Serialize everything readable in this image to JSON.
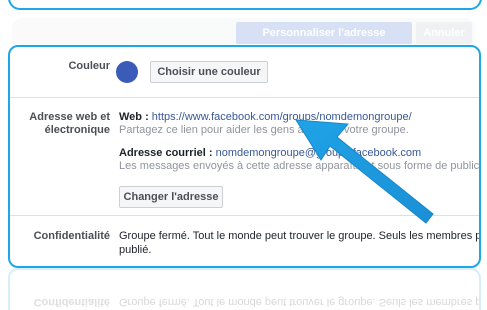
{
  "header": {
    "primary_button": "Personnaliser l'adresse",
    "secondary_button": "Annuler"
  },
  "color_row": {
    "label": "Couleur",
    "swatch_color": "#3b5bb8",
    "button": "Choisir une couleur"
  },
  "address_row": {
    "label_line1": "Adresse web et",
    "label_line2": "électronique",
    "web_prefix": "Web : ",
    "web_url": "https://www.facebook.com/groups/nomdemongroupe/",
    "web_hint": "Partagez ce lien pour aider les gens à trouver votre groupe.",
    "email_prefix": "Adresse courriel : ",
    "email_value": "nomdemongroupe@groups.facebook.com",
    "email_hint": "Les messages envoyés à cette adresse apparaîtront sous forme de publications",
    "change_button": "Changer l'adresse"
  },
  "privacy_row": {
    "label": "Confidentialité",
    "text_line1": "Groupe fermé. Tout le monde peut trouver le groupe. Seuls les membres peuvent",
    "text_line2": "publié."
  },
  "reflection": {
    "label": "Confidentialité",
    "text": "Groupe fermé. Tout le monde peut trouver le groupe. Seuls les membres peuvent"
  },
  "colors": {
    "accent_border": "#1ea7e8",
    "arrow": "#1fa3e6",
    "link": "#385898"
  }
}
